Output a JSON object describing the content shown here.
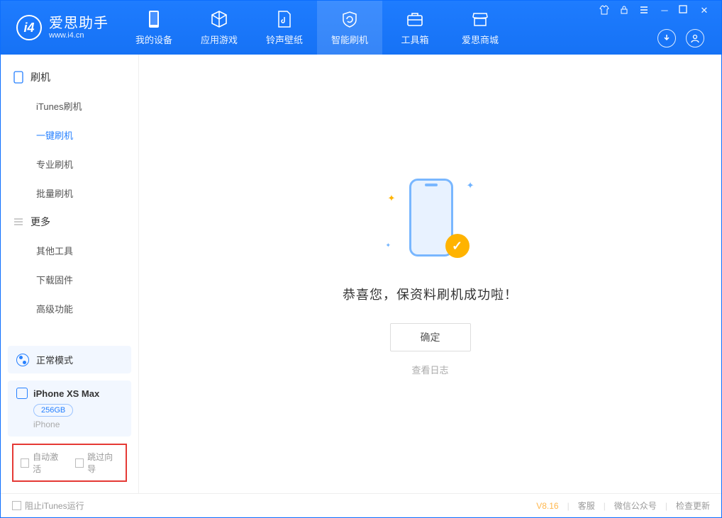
{
  "app": {
    "title": "爱思助手",
    "subtitle": "www.i4.cn"
  },
  "tabs": [
    {
      "label": "我的设备"
    },
    {
      "label": "应用游戏"
    },
    {
      "label": "铃声壁纸"
    },
    {
      "label": "智能刷机"
    },
    {
      "label": "工具箱"
    },
    {
      "label": "爱思商城"
    }
  ],
  "sidebar": {
    "group1": {
      "title": "刷机"
    },
    "items1": [
      {
        "label": "iTunes刷机"
      },
      {
        "label": "一键刷机"
      },
      {
        "label": "专业刷机"
      },
      {
        "label": "批量刷机"
      }
    ],
    "group2": {
      "title": "更多"
    },
    "items2": [
      {
        "label": "其他工具"
      },
      {
        "label": "下载固件"
      },
      {
        "label": "高级功能"
      }
    ],
    "mode": "正常模式",
    "device": {
      "name": "iPhone XS Max",
      "storage": "256GB",
      "type": "iPhone"
    },
    "chk1": "自动激活",
    "chk2": "跳过向导"
  },
  "main": {
    "message": "恭喜您，保资料刷机成功啦！",
    "ok": "确定",
    "log": "查看日志"
  },
  "footer": {
    "block": "阻止iTunes运行",
    "version": "V8.16",
    "link1": "客服",
    "link2": "微信公众号",
    "link3": "检查更新"
  }
}
